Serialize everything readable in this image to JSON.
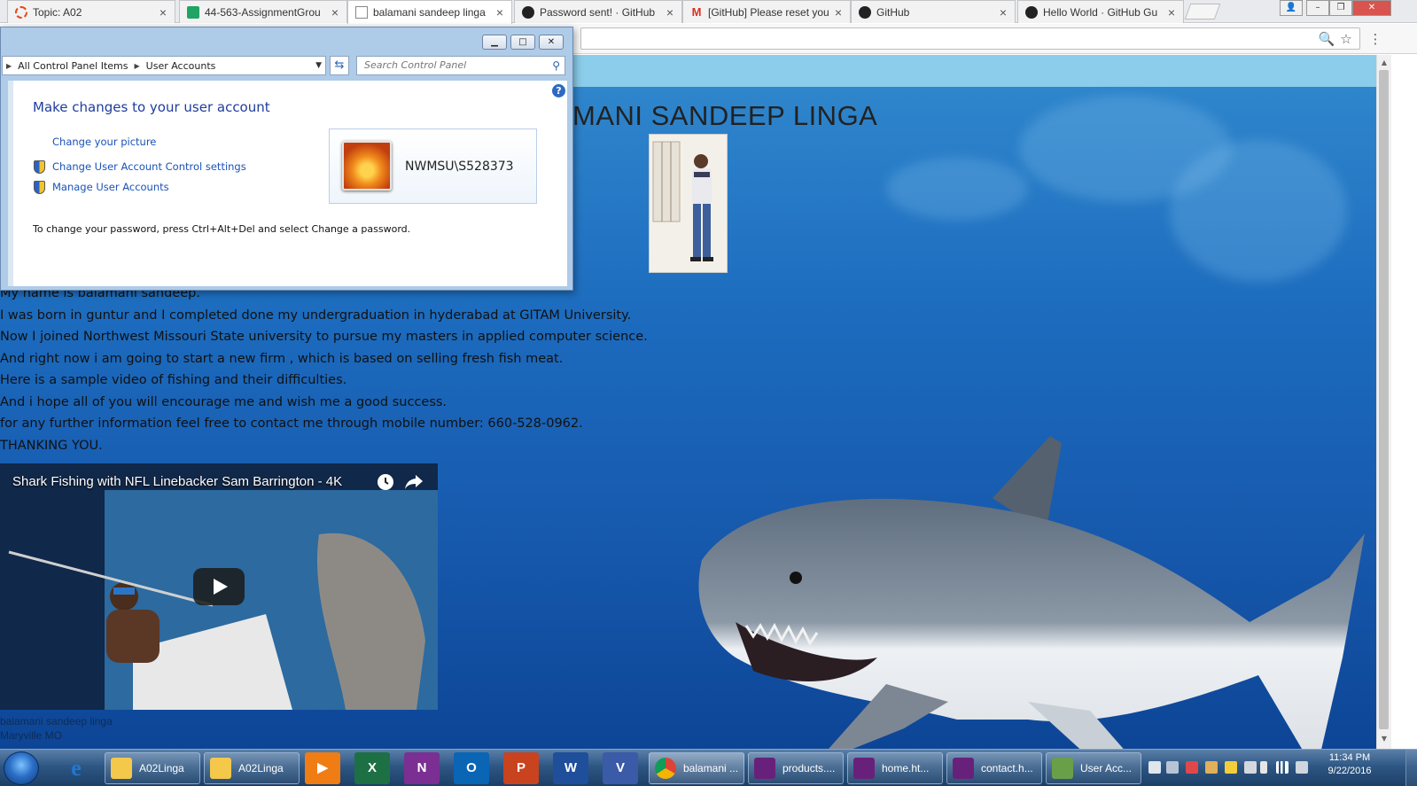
{
  "browser": {
    "tabs": [
      {
        "label": "Topic: A02",
        "icon": "topic-icon",
        "active": false
      },
      {
        "label": "44-563-AssignmentGrou",
        "icon": "sheets-icon",
        "active": false
      },
      {
        "label": "balamani sandeep linga",
        "icon": "document-icon",
        "active": true
      },
      {
        "label": "Password sent! · GitHub",
        "icon": "github-icon",
        "active": false
      },
      {
        "label": "[GitHub] Please reset you",
        "icon": "gmail-icon",
        "active": false
      },
      {
        "label": "GitHub",
        "icon": "github-icon",
        "active": false
      },
      {
        "label": "Hello World · GitHub Gu",
        "icon": "github-icon",
        "active": false
      }
    ],
    "tab_close": "×",
    "window_controls": {
      "user": "👤",
      "minimize": "–",
      "restore": "❐",
      "close": "✕"
    },
    "toolbar_icons": {
      "zoom": "🔍",
      "bookmark": "☆",
      "menu": "⋮"
    }
  },
  "webpage": {
    "heading": "MANI SANDEEP LINGA",
    "bio_lines": [
      "My name is balamani sandeep.",
      "I was born in guntur and I completed done my undergraduation in hyderabad at GITAM University.",
      "Now I joined Northwest Missouri State university to pursue my masters in applied computer science.",
      "And right now i am going to start a new firm , which is based on selling fresh fish meat.",
      "Here is a sample video of fishing and their difficulties.",
      "And i hope all of you will encourage me and wish me a good success.",
      "for any further information feel free to contact me through mobile number: 660-528-0962.",
      "THANKING YOU."
    ],
    "video": {
      "title": "Shark Fishing with NFL Linebacker Sam Barrington - 4K",
      "watch_later_icon": "clock-icon",
      "share_icon": "share-icon"
    },
    "footer": {
      "name": "balamani sandeep linga",
      "location": "Maryville MO"
    }
  },
  "control_panel": {
    "window_buttons": {
      "minimize": "▁",
      "maximize": "□",
      "close": "✕"
    },
    "breadcrumb": [
      "All Control Panel Items",
      "User Accounts"
    ],
    "search_placeholder": "Search Control Panel",
    "help": "?",
    "title": "Make changes to your user account",
    "links": [
      {
        "label": "Change your picture",
        "shield": false
      },
      {
        "label": "Change User Account Control settings",
        "shield": true
      },
      {
        "label": "Manage User Accounts",
        "shield": true
      }
    ],
    "account_name": "NWMSU\\S528373",
    "password_note": "To change your password, press Ctrl+Alt+Del and select Change a password."
  },
  "taskbar": {
    "pinned": [
      {
        "name": "internet-explorer",
        "glyph": "e",
        "color": "#1f78d1"
      },
      {
        "name": "folder-a02linga-1",
        "label": "A02Linga"
      },
      {
        "name": "folder-a02linga-2",
        "label": "A02Linga"
      },
      {
        "name": "media-player",
        "glyph": "▶",
        "color": "#f07c14"
      },
      {
        "name": "excel",
        "glyph": "X",
        "color": "#1d7044"
      },
      {
        "name": "onenote",
        "glyph": "N",
        "color": "#7b2f92"
      },
      {
        "name": "outlook",
        "glyph": "O",
        "color": "#0a65b5"
      },
      {
        "name": "powerpoint",
        "glyph": "P",
        "color": "#c8431e"
      },
      {
        "name": "word",
        "glyph": "W",
        "color": "#1f4e9a"
      },
      {
        "name": "visio",
        "glyph": "V",
        "color": "#3b5aa8"
      }
    ],
    "tasks": [
      {
        "label": "balamani ...",
        "icon": "chrome-icon"
      },
      {
        "label": "products....",
        "icon": "visual-studio-icon"
      },
      {
        "label": "home.ht...",
        "icon": "visual-studio-icon"
      },
      {
        "label": "contact.h...",
        "icon": "visual-studio-icon"
      },
      {
        "label": "User Acc...",
        "icon": "user-accounts-icon"
      }
    ],
    "clock_time": "11:34 PM",
    "clock_date": "9/22/2016"
  }
}
